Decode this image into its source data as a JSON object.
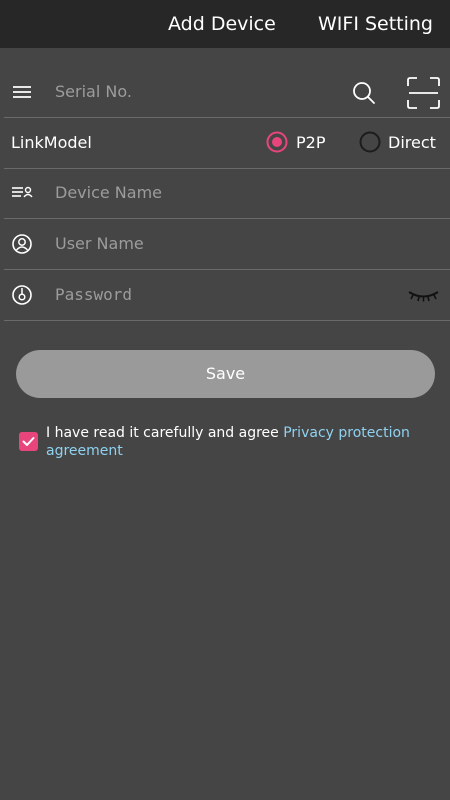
{
  "header": {
    "tabs": [
      {
        "label": "Add Device"
      },
      {
        "label": "WIFI Setting"
      }
    ]
  },
  "form": {
    "serial": {
      "placeholder": "Serial No.",
      "value": ""
    },
    "link_model": {
      "label": "LinkModel",
      "options": [
        {
          "label": "P2P",
          "selected": true
        },
        {
          "label": "Direct",
          "selected": false
        }
      ]
    },
    "device_name": {
      "placeholder": "Device Name",
      "value": ""
    },
    "user_name": {
      "placeholder": "User Name",
      "value": ""
    },
    "password": {
      "placeholder": "Password",
      "value": ""
    }
  },
  "save_label": "Save",
  "agreement": {
    "checked": true,
    "text": "I have read it carefully and agree ",
    "link": "Privacy protection agreement"
  },
  "colors": {
    "background": "#454545",
    "topbar": "#272727",
    "accent": "#e8457c",
    "link": "#8fd2f0",
    "button": "#9a9a9a"
  },
  "icons": {
    "serial_leading": "list-icon",
    "search": "search-icon",
    "scan": "scan-frame-icon",
    "device_leading": "list-user-icon",
    "user_leading": "user-circle-icon",
    "password_leading": "lock-circle-icon",
    "visibility": "eye-closed-icon",
    "check": "check-icon"
  }
}
